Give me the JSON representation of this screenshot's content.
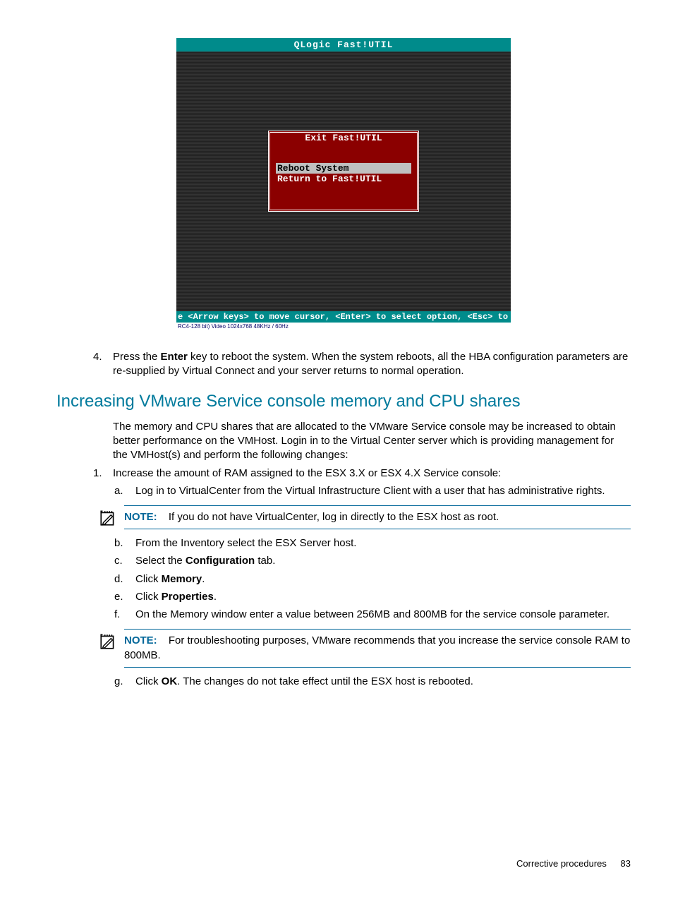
{
  "terminal": {
    "title": "QLogic Fast!UTIL",
    "dialog_title": "Exit Fast!UTIL",
    "menu": [
      "Reboot System",
      "Return to Fast!UTIL"
    ],
    "footer": "e <Arrow keys> to move cursor, <Enter> to select option, <Esc> to back",
    "status": "RC4-128 bit)  Video 1024x768  48KHz / 60Hz"
  },
  "step4": {
    "num": "4.",
    "pre": "Press the ",
    "bold": "Enter",
    "post": " key to reboot the system. When the system reboots, all the HBA configuration parameters are re-supplied by Virtual Connect and your server returns to normal operation."
  },
  "section_heading": "Increasing VMware Service console memory and CPU shares",
  "intro": "The memory and CPU shares that are allocated to the VMware Service console may be increased to obtain better performance on the VMHost. Login in to the Virtual Center server which is providing management for the VMHost(s) and perform the following changes:",
  "step1": {
    "num": "1.",
    "text": "Increase the amount of RAM assigned to the ESX 3.X or ESX 4.X Service console:",
    "a": {
      "num": "a.",
      "text": "Log in to VirtualCenter from the Virtual Infrastructure Client with a user that has administrative rights."
    },
    "b": {
      "num": "b.",
      "text": "From the Inventory select the ESX Server host."
    },
    "c": {
      "num": "c.",
      "pre": "Select the ",
      "bold": "Configuration",
      "post": " tab."
    },
    "d": {
      "num": "d.",
      "pre": "Click ",
      "bold": "Memory",
      "post": "."
    },
    "e": {
      "num": "e.",
      "pre": "Click ",
      "bold": "Properties",
      "post": "."
    },
    "f": {
      "num": "f.",
      "text": "On the Memory window enter a value between 256MB and 800MB for the service console parameter."
    },
    "g": {
      "num": "g.",
      "pre": "Click ",
      "bold": "OK",
      "post": ". The changes do not take effect until the ESX host is rebooted."
    }
  },
  "note1": {
    "label": "NOTE:",
    "text": "If you do not have VirtualCenter, log in directly to the ESX host as root."
  },
  "note2": {
    "label": "NOTE:",
    "text": "For troubleshooting purposes, VMware recommends that you increase the service console RAM to 800MB."
  },
  "footer": {
    "section": "Corrective procedures",
    "page": "83"
  }
}
